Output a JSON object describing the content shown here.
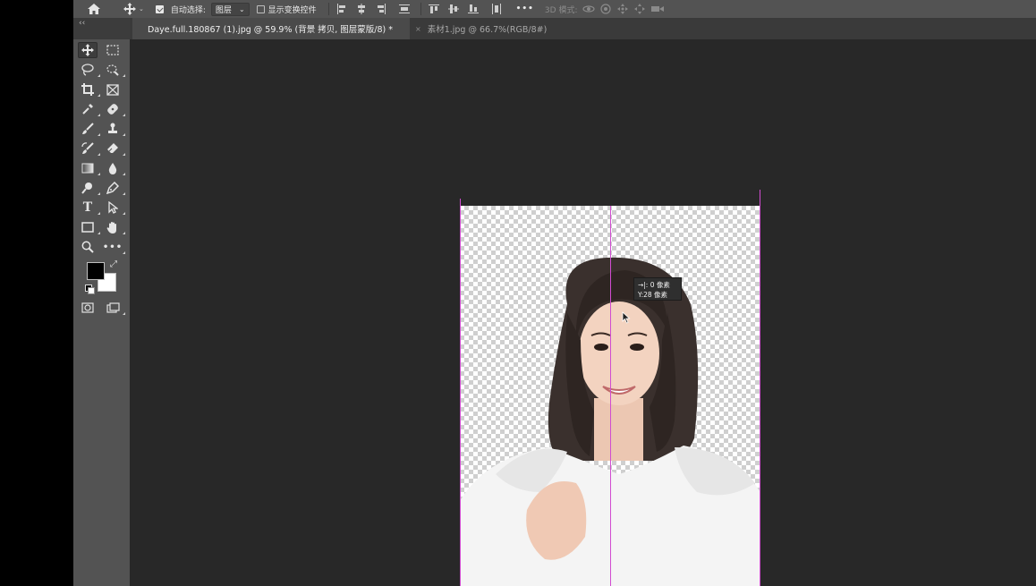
{
  "options_bar": {
    "auto_select_label": "自动选择:",
    "auto_select_checked": true,
    "auto_select_value": "图层",
    "show_transform_label": "显示变换控件",
    "show_transform_checked": false,
    "more_label": "•••",
    "mode_3d_label": "3D 模式:"
  },
  "tabs": [
    {
      "label": "Daye.full.180867 (1).jpg @ 59.9% (背景 拷贝, 图层蒙版/8) *",
      "active": true
    },
    {
      "label": "素材1.jpg @ 66.7%(RGB/8#)",
      "active": false,
      "close": "×"
    }
  ],
  "tools_panel": {
    "collapse": "‹‹",
    "tools": [
      "move-tool",
      "marquee-tool",
      "lasso-tool",
      "quick-select-tool",
      "crop-tool",
      "frame-tool",
      "eyedropper-tool",
      "healing-brush-tool",
      "brush-tool",
      "clone-stamp-tool",
      "history-brush-tool",
      "eraser-tool",
      "gradient-tool",
      "blur-tool",
      "dodge-tool",
      "pen-tool",
      "type-tool",
      "path-select-tool",
      "shape-tool",
      "hand-tool",
      "zoom-tool",
      "more-tools"
    ],
    "type_tool_glyph": "T",
    "more_tools_glyph": "•••",
    "foreground_color": "#000000",
    "background_color": "#ffffff"
  },
  "measure_tooltip": {
    "x_line": "→|: 0 像素",
    "y_line": "Y:28 像素"
  },
  "colors": {
    "guide": "#d14cd1",
    "workspace": "#282828",
    "panel": "#535353"
  }
}
